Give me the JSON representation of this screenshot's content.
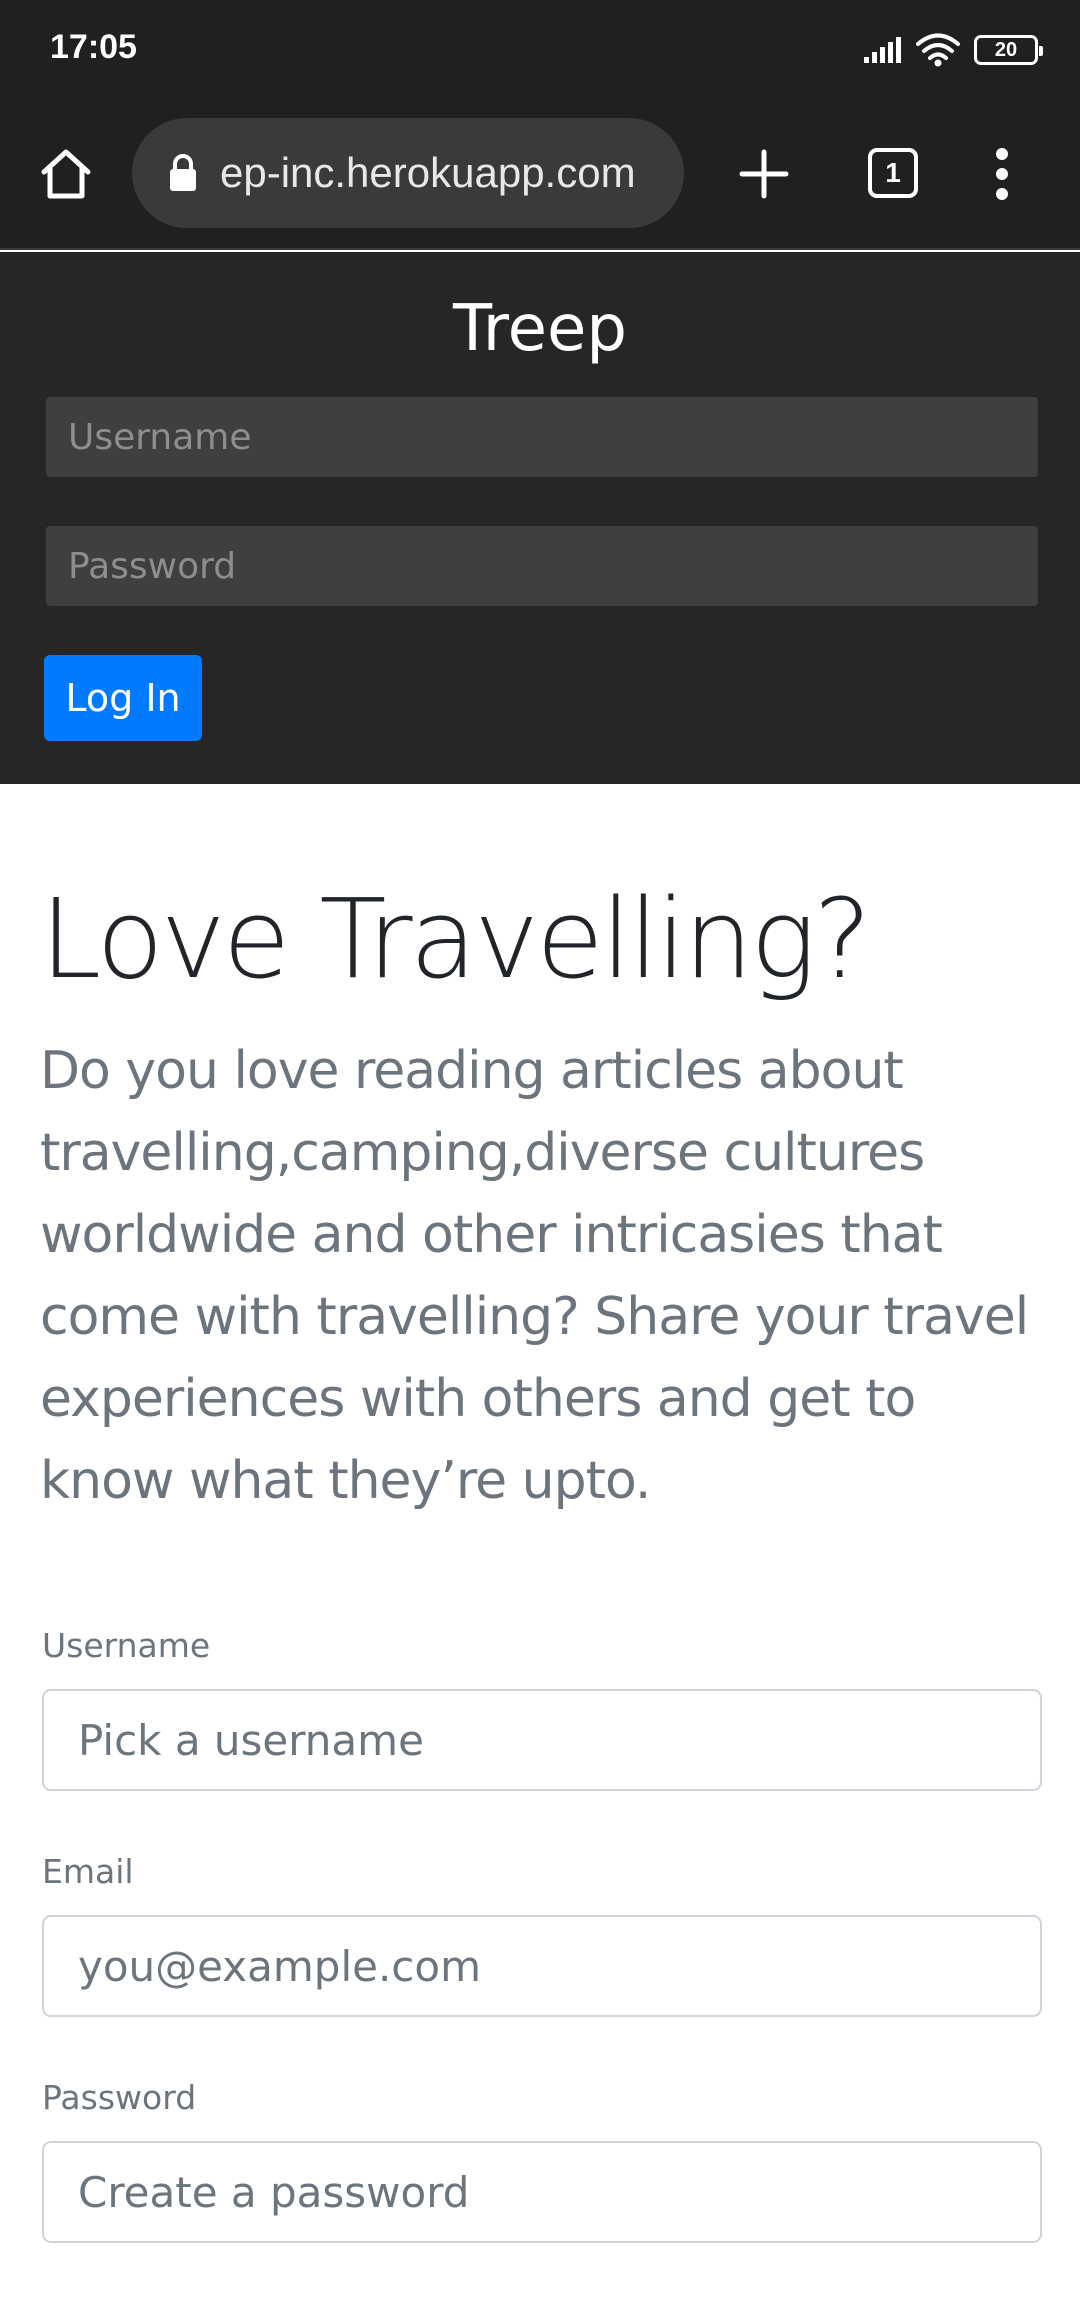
{
  "status_bar": {
    "time": "17:05",
    "battery": "20",
    "icons": [
      "signal-icon",
      "wifi-icon",
      "battery-icon"
    ]
  },
  "browser": {
    "url": "ep-inc.herokuapp.com",
    "tab_count": "1",
    "icons": [
      "home-icon",
      "lock-icon",
      "plus-icon",
      "tabs-icon",
      "menu-icon"
    ]
  },
  "navbar": {
    "brand": "Treep",
    "username_placeholder": "Username",
    "password_placeholder": "Password",
    "login_label": "Log In",
    "accent_color": "#007bff"
  },
  "hero": {
    "title": "Love Travelling?",
    "lead": "Do you love reading articles about travelling,camping,diverse cultures worldwide and other intricasies that come with travelling? Share your travel experiences with others and get to know what they’re upto."
  },
  "signup_form": {
    "username_label": "Username",
    "username_placeholder": "Pick a username",
    "email_label": "Email",
    "email_placeholder": "you@example.com",
    "password_label": "Password",
    "password_placeholder": "Create a password"
  }
}
